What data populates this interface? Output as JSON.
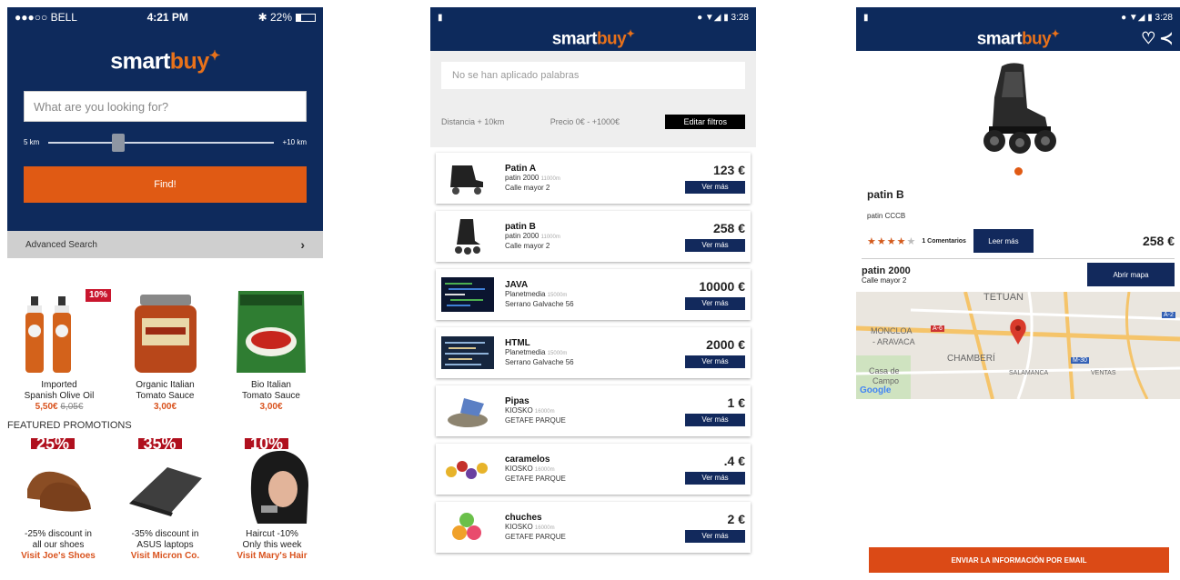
{
  "screen1": {
    "status": {
      "carrier": "●●●○○ BELL",
      "time": "4:21 PM",
      "battery": "22%"
    },
    "logo": {
      "part1": "smart",
      "part2": "buy"
    },
    "search_placeholder": "What are you looking for?",
    "slider": {
      "min_label": "5 km",
      "max_label": "+10 km",
      "value_fraction": 0.28
    },
    "find_label": "Find!",
    "advanced_search_label": "Advanced Search",
    "products": [
      {
        "name_line1": "Imported",
        "name_line2": "Spanish Olive Oil",
        "price": "5,50€",
        "old_price": "6,05€",
        "tag": "10%"
      },
      {
        "name_line1": "Organic Italian",
        "name_line2": "Tomato Sauce",
        "price": "3,00€"
      },
      {
        "name_line1": "Bio Italian",
        "name_line2": "Tomato Sauce",
        "price": "3,00€"
      }
    ],
    "featured_title": "FEATURED PROMOTIONS",
    "promos": [
      {
        "pct": "25%",
        "line1": "-25% discount in",
        "line2": "all our shoes",
        "link": "Visit Joe's Shoes"
      },
      {
        "pct": "35%",
        "line1": "-35% discount in",
        "line2": "ASUS laptops",
        "link": "Visit  Micron Co."
      },
      {
        "pct": "10%",
        "line1": "Haircut -10%",
        "line2": "Only this week",
        "link": "Visit Mary's Hair"
      }
    ]
  },
  "screen2": {
    "status_time": "3:28",
    "search_text": "No se han aplicado palabras",
    "distance": "Distancia + 10km",
    "price_range": "Precio 0€ - +1000€",
    "edit_filters_label": "Editar filtros",
    "ver_mas_label": "Ver más",
    "items": [
      {
        "title": "Patin A",
        "store": "patin 2000",
        "dist": "11000m",
        "address": "Calle mayor 2",
        "price": "123 €"
      },
      {
        "title": "patin B",
        "store": "patin 2000",
        "dist": "11000m",
        "address": "Calle mayor 2",
        "price": "258 €"
      },
      {
        "title": "JAVA",
        "store": "Planetmedia",
        "dist": "15000m",
        "address": "Serrano Galvache 56",
        "price": "10000 €"
      },
      {
        "title": "HTML",
        "store": "Planetmedia",
        "dist": "15000m",
        "address": "Serrano Galvache 56",
        "price": "2000 €"
      },
      {
        "title": "Pipas",
        "store": "KIOSKO",
        "dist": "16000m",
        "address": "GETAFE PARQUE",
        "price": "1 €"
      },
      {
        "title": "caramelos",
        "store": "KIOSKO",
        "dist": "16000m",
        "address": "GETAFE PARQUE",
        "price": ".4 €"
      },
      {
        "title": "chuches",
        "store": "KIOSKO",
        "dist": "16000m",
        "address": "GETAFE PARQUE",
        "price": "2 €"
      }
    ]
  },
  "screen3": {
    "status_time": "3:28",
    "title": "patin B",
    "subtitle": "patin CCCB",
    "rating": 4,
    "comments": "1 Comentarios",
    "leer_mas_label": "Leer más",
    "price": "258 €",
    "shop_name": "patin 2000",
    "shop_address": "Calle mayor 2",
    "map_button_label": "Abrir mapa",
    "map_labels": {
      "tetuan": "TETUAN",
      "moncloa": "MONCLOA",
      "aravaca": "- ARAVACA",
      "chamberi": "CHAMBERÍ",
      "salamanca": "SALAMANCA",
      "ventas": "VENTAS",
      "casa": "Casa de",
      "campo": "Campo",
      "a6": "A-6",
      "m30": "M-30",
      "a2": "A-2",
      "google": "Google"
    },
    "email_label": "ENVIAR LA INFORMACIÓN POR EMAIL"
  }
}
